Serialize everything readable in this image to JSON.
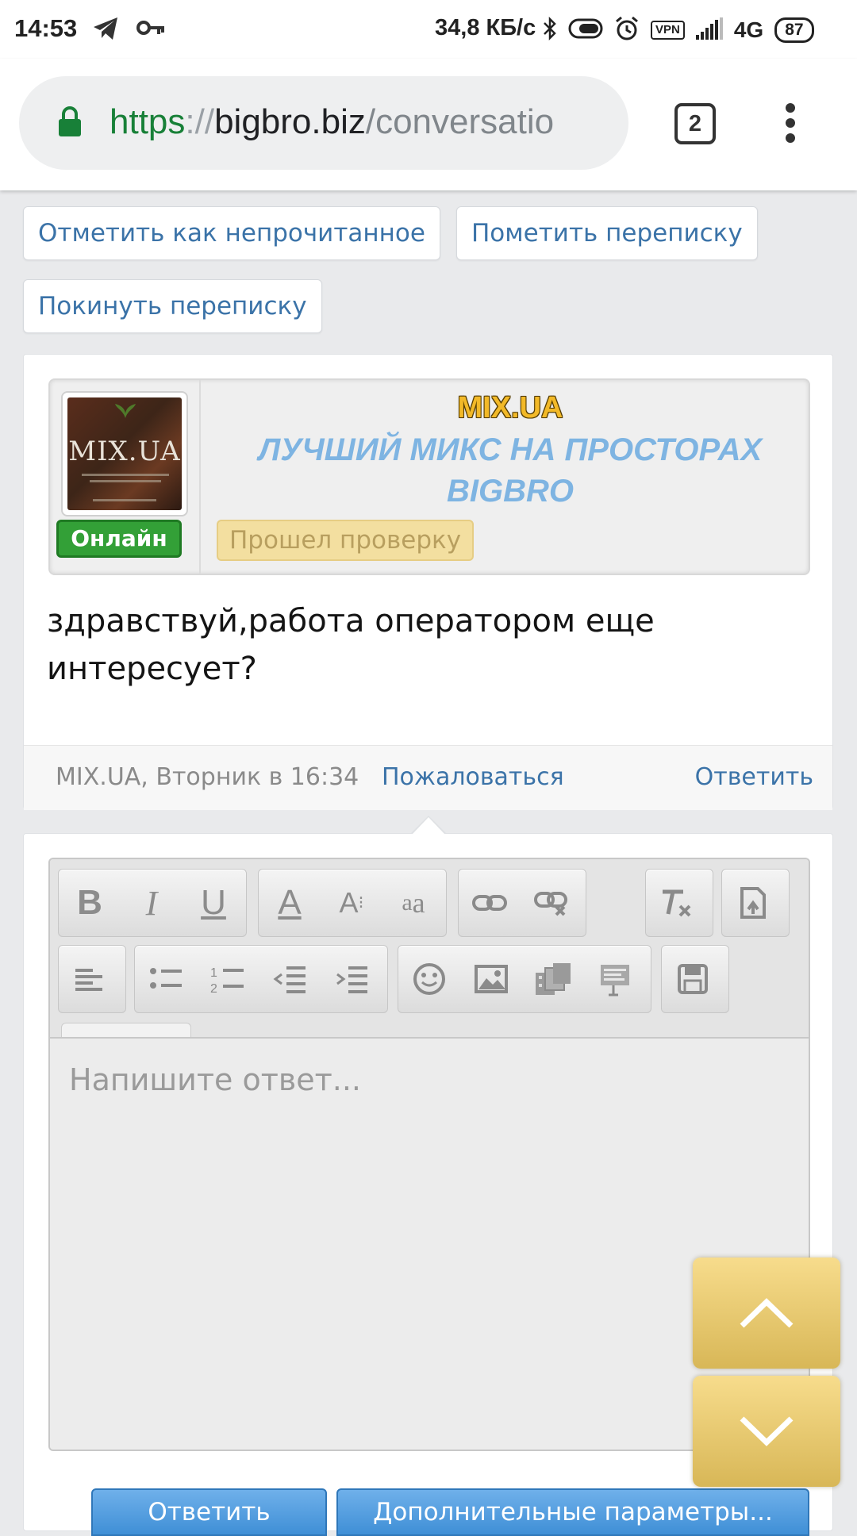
{
  "status_bar": {
    "time": "14:53",
    "speed": "34,8 КБ/с",
    "vpn": "VPN",
    "network": "4G",
    "battery": "87"
  },
  "browser": {
    "url_scheme": "https",
    "url_sep": "://",
    "url_host": "bigbro.biz",
    "url_path": "/conversatio",
    "tab_count": "2"
  },
  "actions": {
    "mark_unread": "Отметить как непрочитанное",
    "mark_conversation": "Пометить переписку",
    "leave_conversation": "Покинуть переписку"
  },
  "message": {
    "avatar_logo": "MIX.UA",
    "status": "Онлайн",
    "username": "MIX.UA",
    "user_title": "ЛУЧШИЙ МИКС НА ПРОСТОРАХ BIGBRO",
    "badge": "Прошел проверку",
    "text": "здравствуй,работа оператором еще интересует?",
    "meta": "MIX.UA, Вторник в 16:34",
    "report": "Пожаловаться",
    "reply": "Ответить"
  },
  "editor": {
    "placeholder": "Напишите ответ...",
    "bold": "B",
    "italic": "I",
    "underline": "U",
    "font_color": "A",
    "font_size": "A",
    "font_family": "a"
  },
  "buttons": {
    "submit": "Ответить",
    "more_options": "Дополнительные параметры..."
  },
  "colors": {
    "link": "#3b73a8",
    "online": "#33a037",
    "username": "#f2b928",
    "user_title": "#7eb4e2",
    "badge_bg": "#f3dfa0",
    "submit": "#3f8fd6",
    "scroll_widget": "#e9c96a"
  }
}
